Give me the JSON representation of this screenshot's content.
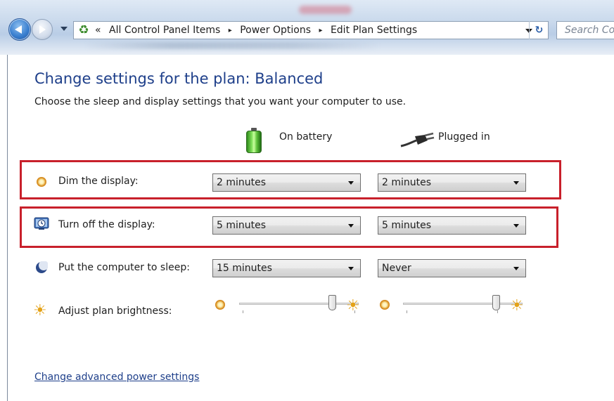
{
  "address_bar": {
    "overflow_chevron": "«",
    "breadcrumbs": [
      "All Control Panel Items",
      "Power Options",
      "Edit Plan Settings"
    ],
    "separator": "▸",
    "search_placeholder": "Search Co",
    "refresh_icon": "refresh-icon",
    "location_icon": "control-panel-icon"
  },
  "page": {
    "title": "Change settings for the plan: Balanced",
    "subtitle": "Choose the sleep and display settings that you want your computer to use."
  },
  "columns": {
    "battery": "On battery",
    "plugged": "Plugged in"
  },
  "settings": [
    {
      "label": "Dim the display:",
      "battery": "2 minutes",
      "plugged": "2 minutes",
      "highlighted": true
    },
    {
      "label": "Turn off the display:",
      "battery": "5 minutes",
      "plugged": "5 minutes",
      "highlighted": true
    },
    {
      "label": "Put the computer to sleep:",
      "battery": "15 minutes",
      "plugged": "Never",
      "highlighted": false
    }
  ],
  "brightness": {
    "label": "Adjust plan brightness:",
    "battery_level": 0.8,
    "plugged_level": 0.8
  },
  "footer": {
    "advanced_link": "Change advanced power settings"
  },
  "colors": {
    "highlight": "#c8202b",
    "title": "#1e3f8a",
    "link": "#1e3f8a"
  }
}
